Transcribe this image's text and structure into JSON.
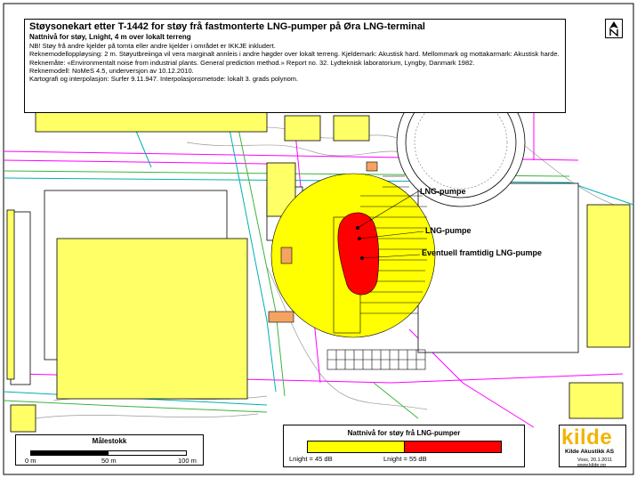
{
  "header": {
    "title": "Støysonekart etter T-1442 for støy frå fastmonterte LNG-pumper på Øra LNG-terminal",
    "subtitle": "Nattnivå for støy, Lnight, 4 m over lokalt terreng",
    "lines": [
      "NB! Støy frå andre kjelder på tomta eller andre kjelder i området er IKKJE inkludert.",
      "Reknemodelloppløysing: 2 m. Støyutbreiinga vil vera marginalt annleis i andre høgder over lokalt terreng. Kjeldemark: Akustisk hard. Mellommark og mottakarmark: Akustisk harde.",
      "Reknemåte: «Environmentalt noise from industrial plants. General prediction method.» Report no. 32. Lydteknisk laboratorium, Lyngby, Danmark 1982.",
      "Reknemodell: NoMeS 4.5, underversjon av 10.12.2010.",
      "Kartografi og interpolasjon: Surfer 9.11.947. Interpolasjonsmetode: lokalt 3. grads polynom."
    ]
  },
  "callouts": {
    "pump1": "LNG-pumpe",
    "pump2": "LNG-pumpe",
    "pump3": "Eventuell framtidig LNG-pumpe"
  },
  "scale": {
    "title": "Målestokk",
    "labels": [
      "0 m",
      "50 m",
      "100 m"
    ]
  },
  "legend": {
    "title": "Nattnivå for støy frå LNG-pumper",
    "label_low": "Lnight = 45 dB",
    "label_high": "Lnight = 55 dB",
    "colors": {
      "yellow": "#ffff00",
      "red": "#ff0000"
    }
  },
  "logo": {
    "word": "kilde",
    "company": "Kilde Akustikk AS",
    "place_date": "Voss, 20.1.2011",
    "web": "www.kilde.no"
  },
  "colors": {
    "buildings": "#ffff66",
    "zone45": "#ffff00",
    "zone55": "#ff0000",
    "road_magenta": "#ff00ff",
    "road_cyan": "#00b0b0",
    "road_green": "#3cb43c"
  }
}
